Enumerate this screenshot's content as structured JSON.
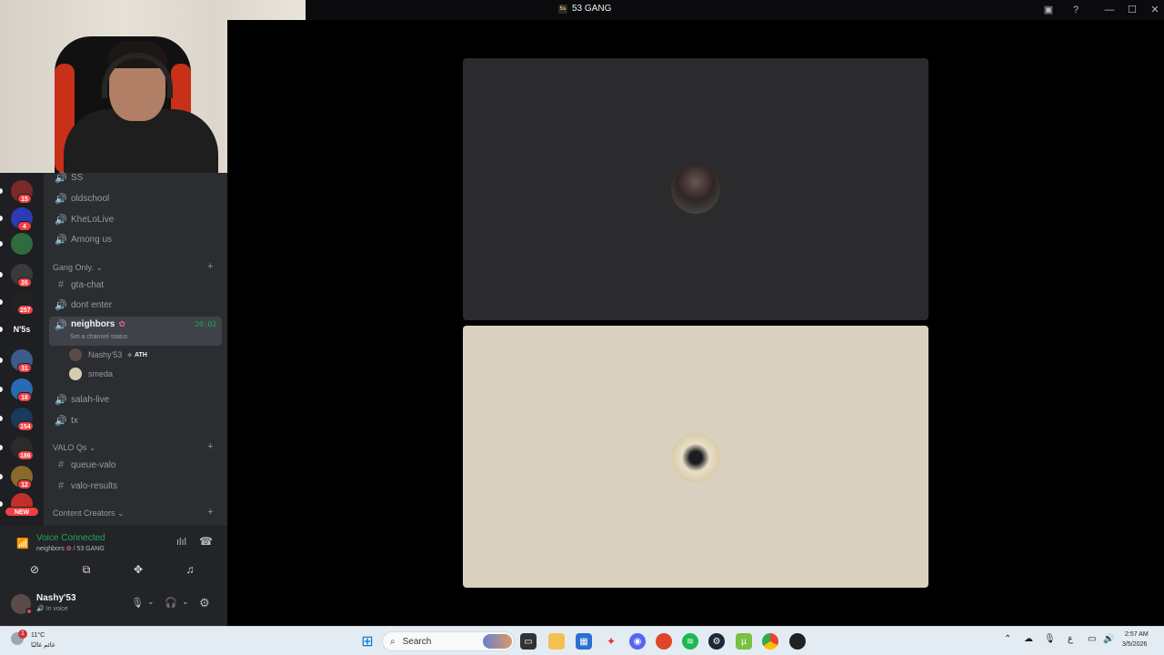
{
  "window": {
    "title": "53 GANG",
    "server_icon_text": "5s"
  },
  "rail": {
    "servers": [
      {
        "badge": "15",
        "color": "#7a2a2a"
      },
      {
        "badge": "4",
        "color": "#2d3ab5"
      },
      {
        "badge": "",
        "color": "#2f6b3e"
      },
      {
        "badge": "26",
        "color": "#3a3a3a"
      },
      {
        "badge": "257",
        "color": "#222222"
      },
      {
        "badge": "",
        "color": "#1e1f22",
        "text": "N'5s"
      },
      {
        "badge": "31",
        "color": "#3b5b8a"
      },
      {
        "badge": "18",
        "color": "#2a6ab0"
      },
      {
        "badge": "154",
        "color": "#1a3a5a"
      },
      {
        "badge": "186",
        "color": "#2b2b2b"
      },
      {
        "badge": "12",
        "color": "#8a6a2a"
      },
      {
        "badge": "NEW",
        "color": "#c0302a"
      }
    ]
  },
  "channels": {
    "top_items": [
      {
        "name": "SS",
        "icon": "speaker"
      },
      {
        "name": "oldschool",
        "icon": "speaker"
      },
      {
        "name": "KheLoLive",
        "icon": "speaker"
      },
      {
        "name": "Among us",
        "icon": "speaker"
      }
    ],
    "category_gang": "Gang Only.",
    "gang_items": [
      {
        "name": "gta-chat",
        "icon": "hash"
      },
      {
        "name": "dont enter",
        "icon": "speaker"
      }
    ],
    "active_channel": {
      "name": "neighbors",
      "timer": "20:02",
      "status": "Set a channel status"
    },
    "members": [
      {
        "name": "Nashy'53",
        "tag": "ATH"
      },
      {
        "name": "smeda",
        "tag": ""
      }
    ],
    "after_items": [
      {
        "name": "salah-live",
        "icon": "speaker"
      },
      {
        "name": "tx",
        "icon": "speaker"
      }
    ],
    "category_valo": "VALO Qs",
    "valo_items": [
      {
        "name": "queue-valo",
        "icon": "hash"
      },
      {
        "name": "valo-results",
        "icon": "hash"
      }
    ],
    "category_content": "Content Creators"
  },
  "voice": {
    "status": "Voice Connected",
    "location_channel": "neighbors",
    "location_server": "/ 53 GANG",
    "status_color": "#23a559"
  },
  "user": {
    "name": "Nashy'53",
    "status": "In voice"
  },
  "taskbar": {
    "weather_temp": "11°C",
    "weather_desc": "غائم غالبًا",
    "search_placeholder": "Search",
    "time": "2:57 AM",
    "date": "3/5/2026",
    "lang": "ع",
    "notification_count": "1"
  },
  "colors": {
    "tile_top": "#2b2b2d",
    "tile_bottom": "#d9d1c0",
    "accent_green": "#23a559"
  }
}
